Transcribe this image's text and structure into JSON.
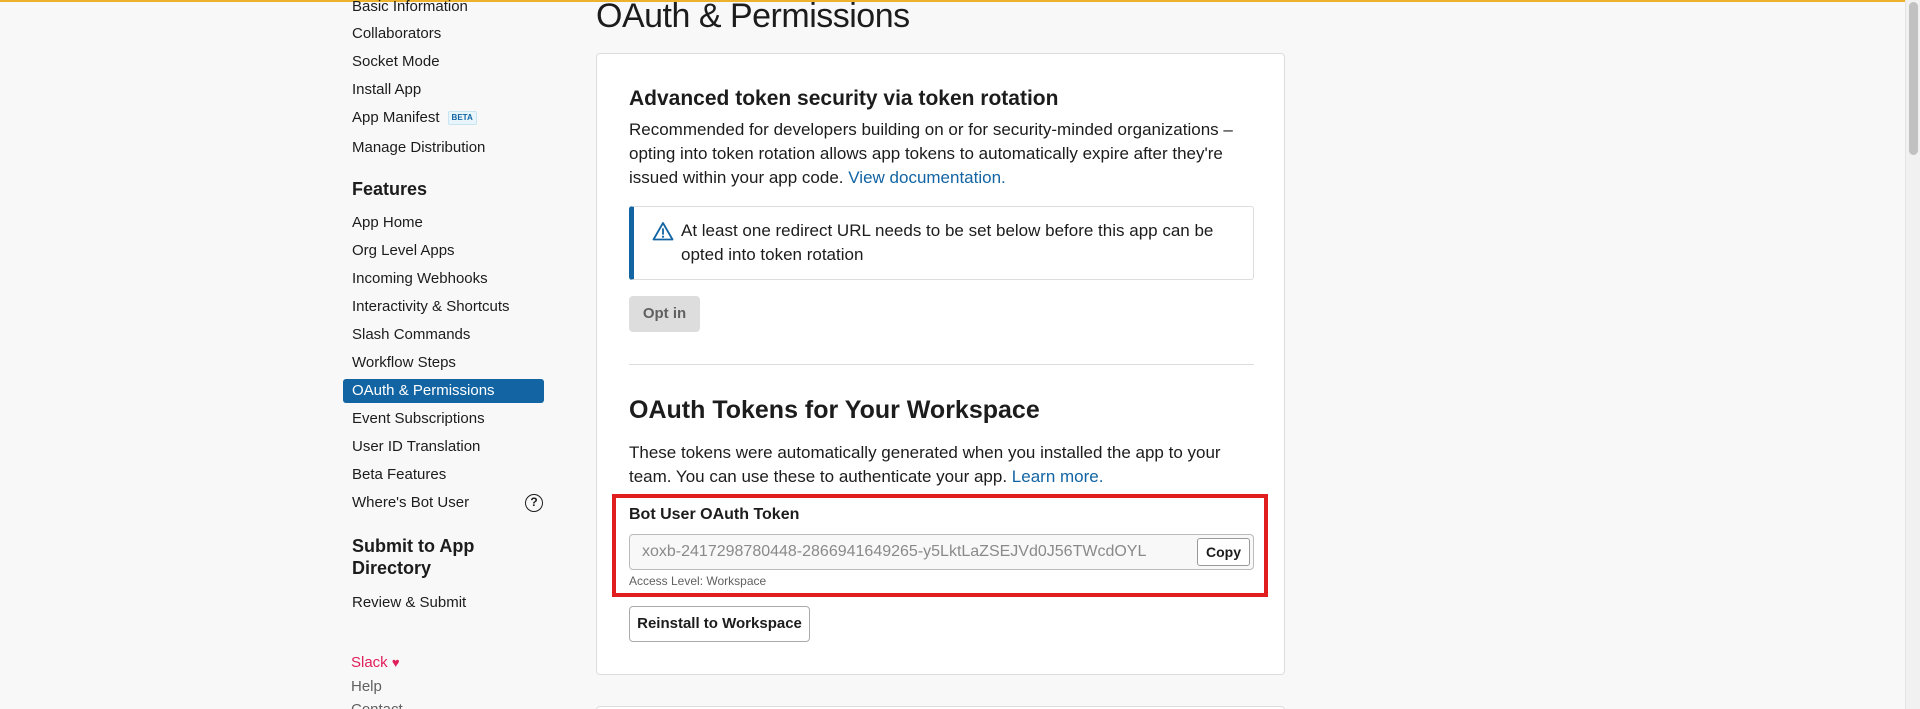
{
  "sidebar": {
    "settings_items": [
      {
        "label": "Basic Information"
      },
      {
        "label": "Collaborators"
      },
      {
        "label": "Socket Mode"
      },
      {
        "label": "Install App"
      },
      {
        "label": "App Manifest",
        "badge": "BETA"
      },
      {
        "label": "Manage Distribution"
      }
    ],
    "features_title": "Features",
    "features_items": [
      {
        "label": "App Home"
      },
      {
        "label": "Org Level Apps"
      },
      {
        "label": "Incoming Webhooks"
      },
      {
        "label": "Interactivity & Shortcuts"
      },
      {
        "label": "Slash Commands"
      },
      {
        "label": "Workflow Steps"
      },
      {
        "label": "OAuth & Permissions",
        "active": true
      },
      {
        "label": "Event Subscriptions"
      },
      {
        "label": "User ID Translation"
      },
      {
        "label": "Beta Features"
      },
      {
        "label": "Where's Bot User"
      }
    ],
    "help_glyph": "?",
    "submit_title": "Submit to App Directory",
    "submit_items": [
      {
        "label": "Review & Submit"
      }
    ],
    "footer": {
      "slack_label": "Slack",
      "heart_glyph": "♥",
      "help_label": "Help",
      "contact_label": "Contact"
    }
  },
  "page": {
    "title": "OAuth & Permissions"
  },
  "token_rotation": {
    "heading": "Advanced token security via token rotation",
    "description": "Recommended for developers building on or for security-minded organizations – opting into token rotation allows app tokens to automatically expire after they're issued within your app code.",
    "doc_link": "View documentation.",
    "alert_text": "At least one redirect URL needs to be set below before this app can be opted into token rotation",
    "opt_in_label": "Opt in"
  },
  "oauth_tokens": {
    "heading": "OAuth Tokens for Your Workspace",
    "description": "These tokens were automatically generated when you installed the app to your team. You can use these to authenticate your app.",
    "learn_more": "Learn more.",
    "bot_token_label": "Bot User OAuth Token",
    "bot_token_value": "xoxb-2417298780448-2866941649265-y5LktLaZSEJVd0J56TWcdOYL",
    "copy_label": "Copy",
    "access_level": "Access Level: Workspace",
    "reinstall_label": "Reinstall to Workspace"
  },
  "colors": {
    "accent": "#1264a3",
    "highlight": "#e01e1e",
    "slack_pink": "#e01e5a",
    "top_bar": "#ecb22e"
  }
}
